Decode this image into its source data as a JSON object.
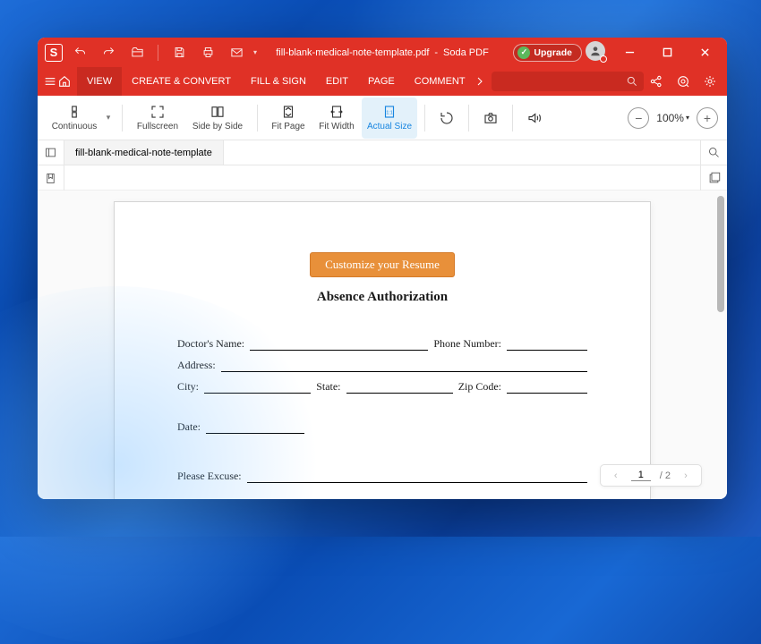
{
  "titlebar": {
    "doc_name": "fill-blank-medical-note-template.pdf",
    "separator": "-",
    "app_name": "Soda PDF",
    "upgrade_label": "Upgrade"
  },
  "menubar": {
    "tabs": [
      "VIEW",
      "CREATE & CONVERT",
      "FILL & SIGN",
      "EDIT",
      "PAGE",
      "COMMENT"
    ]
  },
  "ribbon": {
    "continuous": "Continuous",
    "fullscreen": "Fullscreen",
    "side_by_side": "Side by Side",
    "fit_page": "Fit Page",
    "fit_width": "Fit Width",
    "actual_size": "Actual Size",
    "zoom": "100%"
  },
  "doc_tab": "fill-blank-medical-note-template",
  "form": {
    "cta": "Customize your Resume",
    "title": "Absence Authorization",
    "doctors_name": "Doctor's Name:",
    "phone_number": "Phone Number:",
    "address": "Address:",
    "city": "City:",
    "state": "State:",
    "zip_code": "Zip Code:",
    "date": "Date:",
    "please_excuse": "Please Excuse:"
  },
  "pager": {
    "current": "1",
    "total": "2"
  }
}
